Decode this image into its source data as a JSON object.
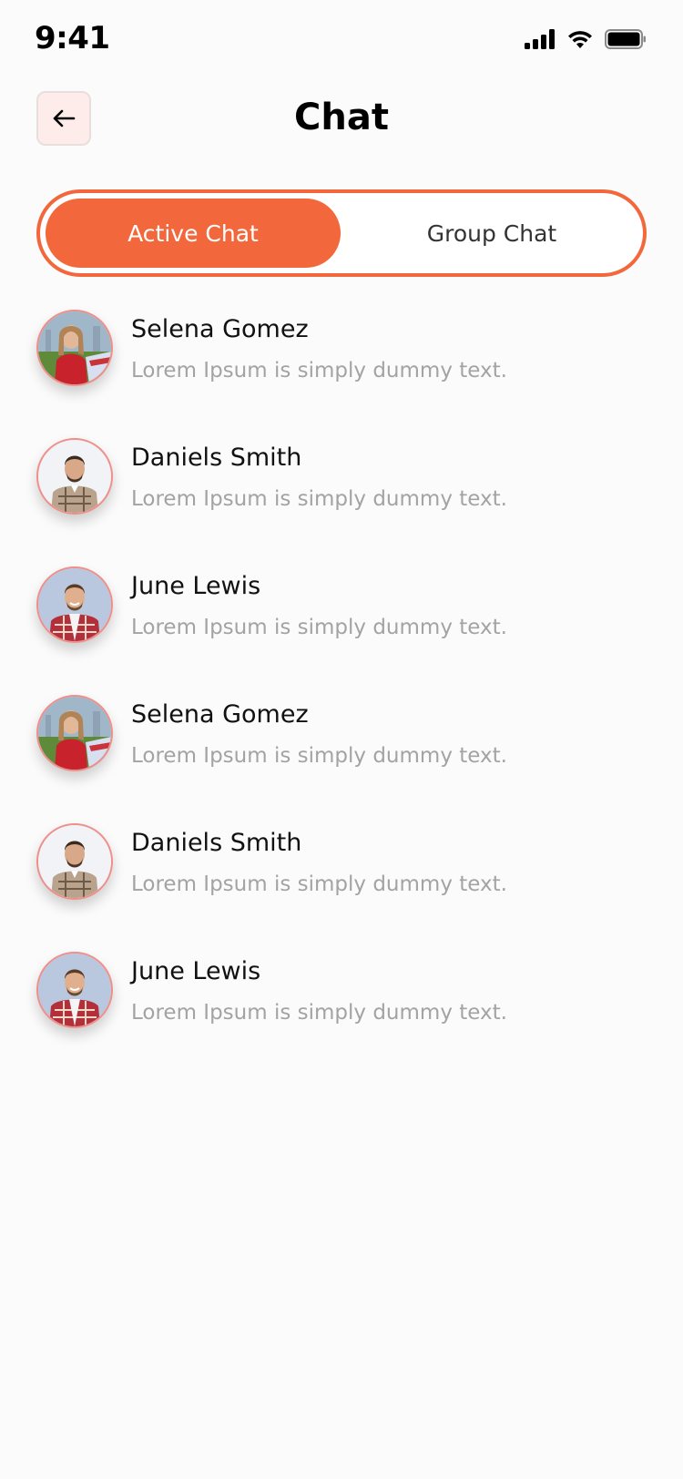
{
  "status_bar": {
    "time": "9:41",
    "icons": [
      "signal-icon",
      "wifi-icon",
      "battery-icon"
    ]
  },
  "header": {
    "title": "Chat",
    "back_icon": "arrow-left-icon"
  },
  "tabs": [
    {
      "label": "Active Chat",
      "active": true
    },
    {
      "label": "Group Chat",
      "active": false
    }
  ],
  "chats": [
    {
      "name": "Selena Gomez",
      "preview": "Lorem Ipsum is simply dummy text.",
      "avatar": "woman-red-shirt"
    },
    {
      "name": "Daniels Smith",
      "preview": "Lorem Ipsum is simply dummy text.",
      "avatar": "man-plaid-shirt"
    },
    {
      "name": "June Lewis",
      "preview": "Lorem Ipsum is simply dummy text.",
      "avatar": "man-red-plaid-shirt"
    },
    {
      "name": "Selena Gomez",
      "preview": "Lorem Ipsum is simply dummy text.",
      "avatar": "woman-red-shirt"
    },
    {
      "name": "Daniels Smith",
      "preview": "Lorem Ipsum is simply dummy text.",
      "avatar": "man-plaid-shirt"
    },
    {
      "name": "June Lewis",
      "preview": "Lorem Ipsum is simply dummy text.",
      "avatar": "man-red-plaid-shirt"
    }
  ],
  "colors": {
    "accent": "#f2673b",
    "background": "#fbfbfb",
    "preview_text": "#a3a3a3",
    "back_button_bg": "#fdecea"
  }
}
